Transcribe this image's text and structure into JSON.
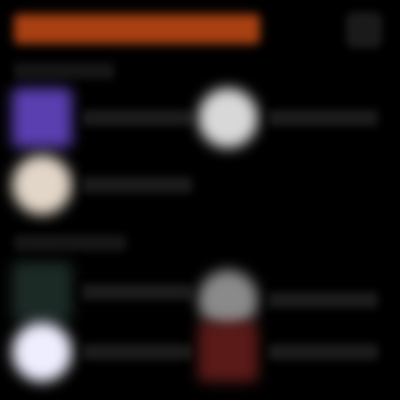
{
  "header": {
    "title": "",
    "accent_color": "#a84012",
    "action_icon": "more-icon"
  },
  "sections": [
    {
      "label": "",
      "items": [
        {
          "label": "",
          "icon": "app-icon",
          "color": "#5a3fb0",
          "shape": "square"
        },
        {
          "label": "",
          "icon": "app-icon",
          "color": "#d8d8d8",
          "shape": "round"
        },
        {
          "label": "",
          "icon": "app-icon",
          "color": "#e2d6c8",
          "shape": "round"
        }
      ]
    },
    {
      "label": "",
      "items": [
        {
          "label": "",
          "icon": "app-icon",
          "color": "#1c2a26",
          "shape": "square"
        },
        {
          "label": "",
          "icon": "app-icon",
          "color": "#8a8a8a",
          "shape": "round"
        },
        {
          "label": "",
          "icon": "app-icon",
          "color": "#eeeeff",
          "shape": "round"
        },
        {
          "label": "",
          "icon": "app-icon",
          "color": "#5a1a18",
          "shape": "square"
        }
      ]
    }
  ]
}
